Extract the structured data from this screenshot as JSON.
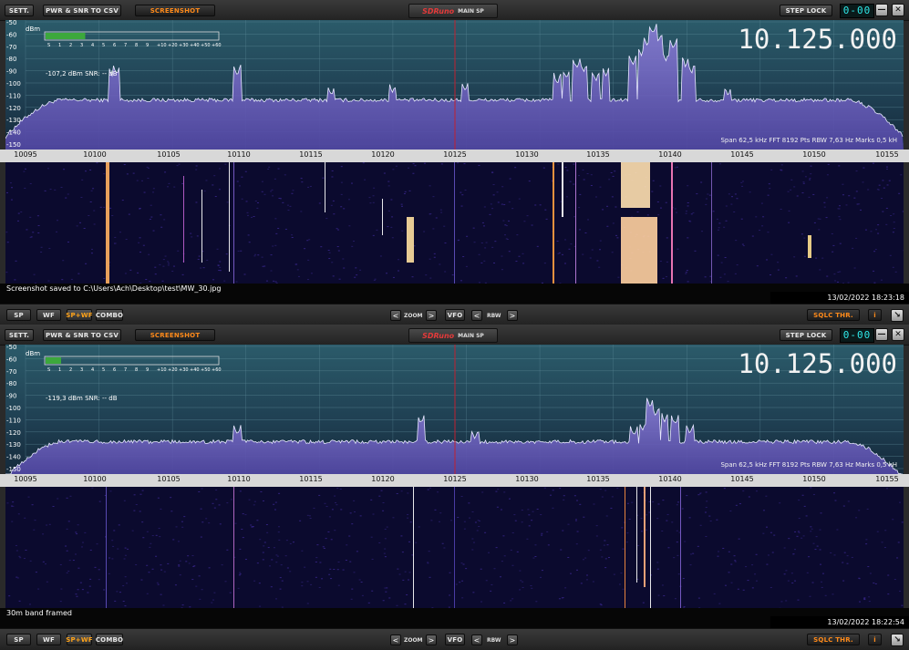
{
  "colors": {
    "accent_orange": "#ff8a1a",
    "lcd_cyan": "#2fe8e8",
    "brand_red": "#e23a3a",
    "trace_white": "#e8e8ff",
    "fill_violet": "#6a5fb8",
    "cursor_red": "#c02030"
  },
  "toolbar": {
    "sett": "SETT.",
    "pwr_csv": "PWR & SNR TO CSV",
    "screenshot": "SCREENSHOT",
    "brand": "SDRuno",
    "title": "MAIN SP",
    "step_lock": "STEP LOCK",
    "lcd": "0-00"
  },
  "window": {
    "minimize": "—",
    "close": "✕"
  },
  "meter": {
    "unit": "dBm",
    "scale": [
      "S",
      "1",
      "2",
      "3",
      "4",
      "5",
      "6",
      "7",
      "8",
      "9",
      "+10",
      "+20",
      "+30",
      "+40",
      "+50",
      "+60"
    ]
  },
  "db_scale": [
    "-50",
    "-60",
    "-70",
    "-80",
    "-90",
    "-100",
    "-110",
    "-120",
    "-130",
    "-140",
    "-150"
  ],
  "freq_axis": [
    "10095",
    "10100",
    "10105",
    "10110",
    "10115",
    "10120",
    "10125",
    "10130",
    "10135",
    "10140",
    "10145",
    "10150",
    "10155"
  ],
  "frequency_display": "10.125.000",
  "spectrum_info": "Span 62,5 kHz   FFT 8192 Pts   RBW 7,63 Hz   Marks 0,5 kH",
  "bottom": {
    "sp": "SP",
    "wf": "WF",
    "spwf": "SP+WF",
    "combo": "COMBO",
    "zoom": "ZOOM",
    "vfo": "VFO",
    "rbw": "RBW",
    "sqlc": "SQLC THR.",
    "info": "i",
    "expand": "↘",
    "left": "<",
    "right": ">"
  },
  "panels": [
    {
      "level_text": "-107,2 dBm   SNR: -- dB",
      "meter_fill": 0.23,
      "status": "Screenshot saved to C:\\Users\\Ach\\Desktop\\test\\MW_30.jpg",
      "timestamp": "13/02/2022 18:23:18"
    },
    {
      "level_text": "-119,3 dBm   SNR: -- dB",
      "meter_fill": 0.09,
      "status": "30m band framed",
      "timestamp": "13/02/2022 18:22:54"
    }
  ]
}
